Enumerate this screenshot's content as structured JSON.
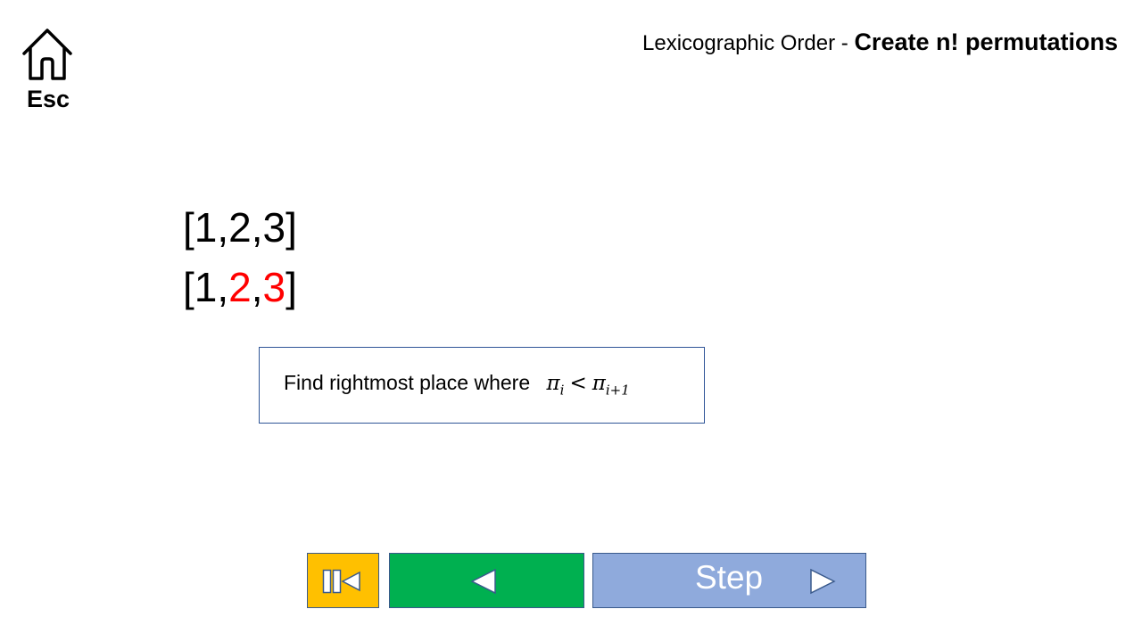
{
  "home": {
    "icon": "home-icon",
    "label": "Esc"
  },
  "header": {
    "title_prefix": "Lexicographic Order - ",
    "title_strong": "Create n! permutations"
  },
  "permutations": {
    "line1": {
      "open": "[",
      "a": "1",
      "sep1": ",",
      "b": "2",
      "sep2": ",",
      "c": "3",
      "close": "]"
    },
    "line2": {
      "open": "[",
      "a": "1",
      "sep1": ",",
      "b": "2",
      "sep2": ",",
      "c": "3",
      "close": "]"
    },
    "highlight_color": "#ff0000"
  },
  "hint": {
    "text": "Find rightmost place where",
    "pi": "π",
    "sub_i": "i",
    "op": "<",
    "sub_i1": "i+1"
  },
  "controls": {
    "reset_icon": "skip-to-start-icon",
    "reset_color": "#ffc000",
    "back_icon": "triangle-left-icon",
    "back_color": "#00b050",
    "step_label": "Step",
    "step_icon": "triangle-right-icon",
    "step_color": "#8faadc"
  }
}
